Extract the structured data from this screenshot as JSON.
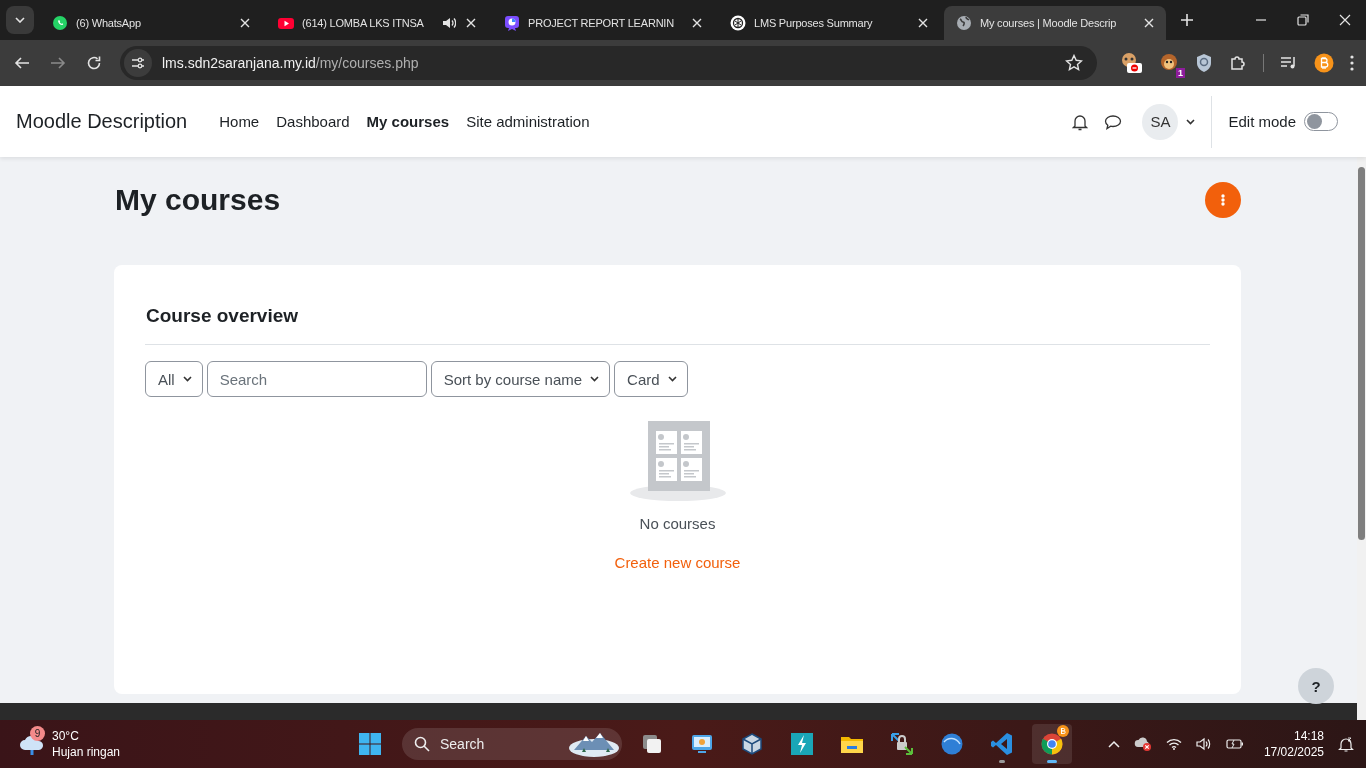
{
  "browser": {
    "tabs": [
      {
        "title": "(6) WhatsApp",
        "audio": false,
        "selected": false
      },
      {
        "title": "(614) LOMBA LKS ITNSA",
        "audio": true,
        "selected": false
      },
      {
        "title": "PROJECT REPORT LEARNIN",
        "audio": false,
        "selected": false
      },
      {
        "title": "LMS Purposes Summary",
        "audio": false,
        "selected": false
      },
      {
        "title": "My courses | Moodle Descrip",
        "audio": false,
        "selected": true
      }
    ],
    "address": {
      "host": "lms.sdn2saranjana.my.id",
      "path": "/my/courses.php"
    },
    "extension_badge": "1"
  },
  "navbar": {
    "site_name": "Moodle Description",
    "items": [
      {
        "label": "Home",
        "selected": false
      },
      {
        "label": "Dashboard",
        "selected": false
      },
      {
        "label": "My courses",
        "selected": true
      },
      {
        "label": "Site administration",
        "selected": false
      }
    ],
    "avatar": "SA",
    "edit_mode": {
      "label": "Edit mode",
      "on": false
    }
  },
  "page": {
    "title": "My courses",
    "card_title": "Course overview",
    "filters": [
      {
        "kind": "dropdown",
        "label": "All"
      },
      {
        "kind": "search",
        "placeholder": "Search"
      },
      {
        "kind": "dropdown",
        "label": "Sort by course name"
      },
      {
        "kind": "dropdown",
        "label": "Card"
      }
    ],
    "empty_message": "No courses",
    "create_link": "Create new course",
    "help": "?"
  },
  "taskbar": {
    "weather": {
      "badge": "9",
      "temperature": "30°C",
      "condition": "Hujan ringan"
    },
    "search_placeholder": "Search",
    "apps": [
      {
        "kind": "taskview",
        "running": false,
        "selected": false
      },
      {
        "kind": "monitor",
        "running": false,
        "selected": false
      },
      {
        "kind": "cube",
        "running": false,
        "selected": false
      },
      {
        "kind": "bolt",
        "running": false,
        "selected": false
      },
      {
        "kind": "folder",
        "running": false,
        "selected": false
      },
      {
        "kind": "netlock",
        "running": false,
        "selected": false
      },
      {
        "kind": "sphere",
        "running": false,
        "selected": false
      },
      {
        "kind": "code",
        "running": true,
        "selected": false
      },
      {
        "kind": "chrome",
        "running": true,
        "selected": true
      }
    ],
    "time": "14:18",
    "date": "17/02/2025"
  }
}
